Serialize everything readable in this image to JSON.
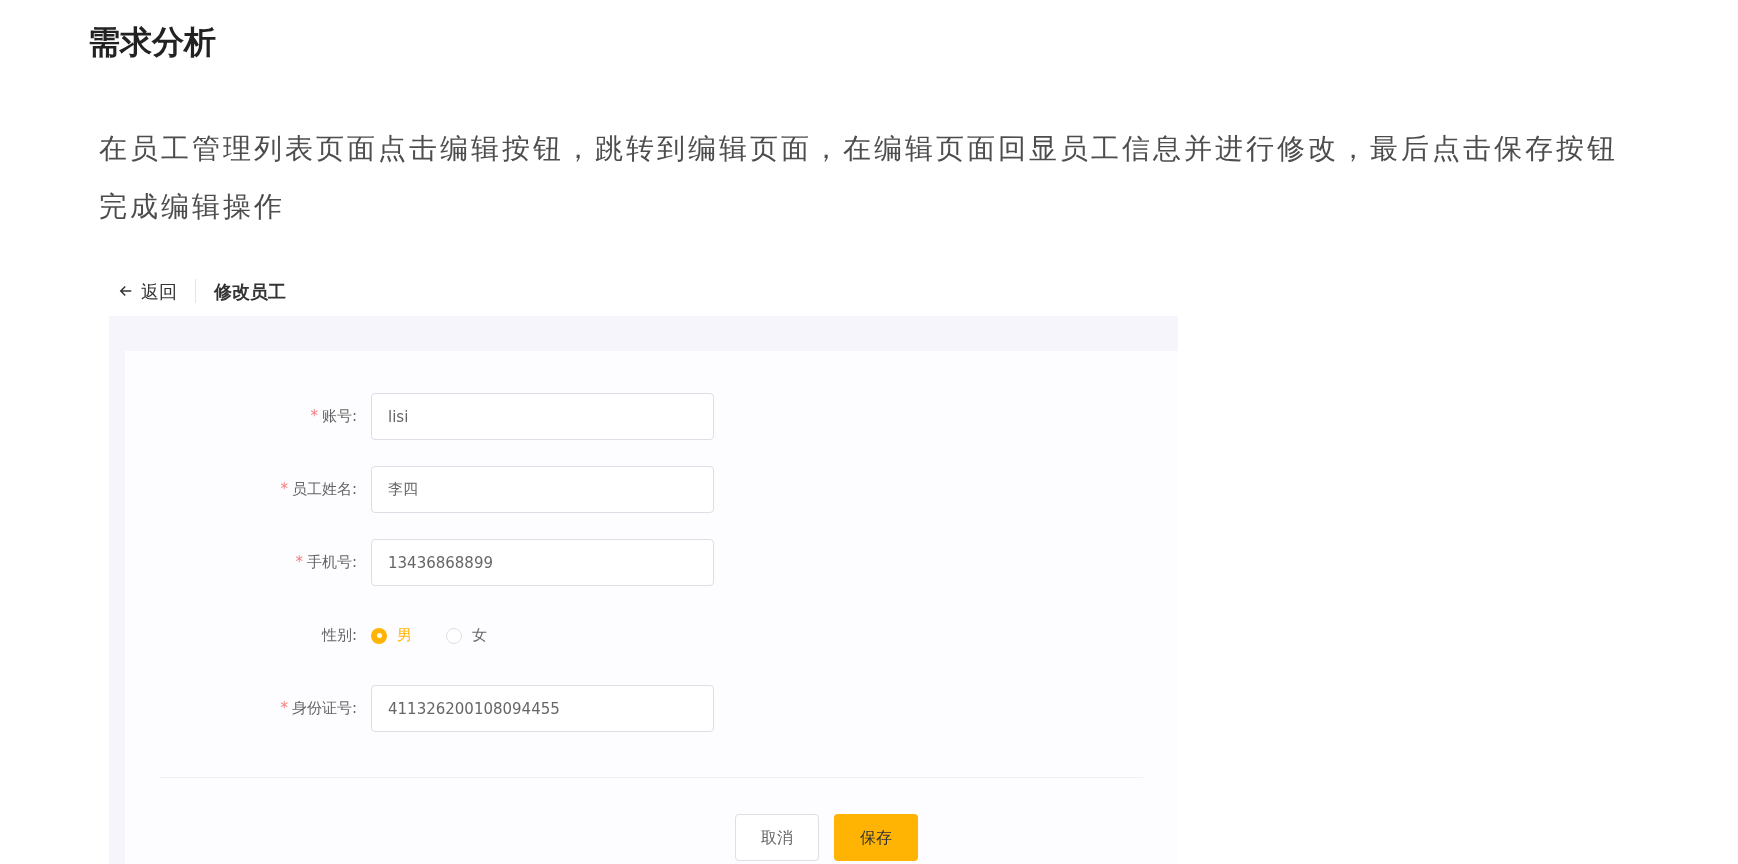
{
  "heading": "需求分析",
  "paragraph": "在员工管理列表页面点击编辑按钮，跳转到编辑页面，在编辑页面回显员工信息并进行修改，最后点击保存按钮完成编辑操作",
  "screenshot": {
    "back_link": "返回",
    "page_title": "修改员工",
    "fields": [
      {
        "kind": "input",
        "required_mark": "*",
        "label": "账号:",
        "value": "lisi"
      },
      {
        "kind": "input",
        "required_mark": "*",
        "label": "员工姓名:",
        "value": "李四"
      },
      {
        "kind": "input",
        "required_mark": "*",
        "label": "手机号:",
        "value": "13436868899"
      },
      {
        "kind": "radio",
        "label": "性别:",
        "options": [
          {
            "label": "男",
            "selected": true
          },
          {
            "label": "女",
            "selected": false
          }
        ]
      },
      {
        "kind": "input",
        "required_mark": "*",
        "label": "身份证号:",
        "value": "411326200108094455"
      }
    ],
    "buttons": [
      {
        "kind": "secondary",
        "label": "取消"
      },
      {
        "kind": "primary",
        "label": "保存"
      }
    ]
  }
}
